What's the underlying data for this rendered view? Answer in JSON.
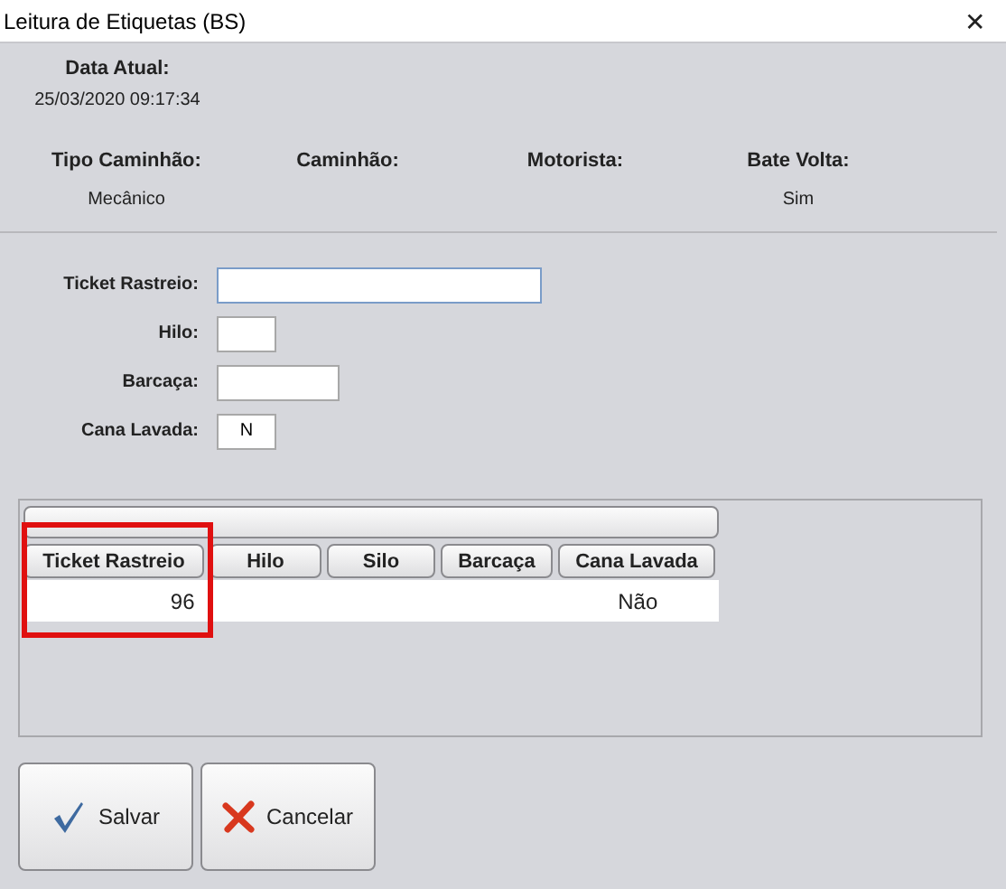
{
  "window": {
    "title": "Leitura de Etiquetas (BS)",
    "close": "✕"
  },
  "date": {
    "label": "Data Atual:",
    "value": "25/03/2020 09:17:34"
  },
  "info": [
    {
      "label": "Tipo Caminhão:",
      "value": "Mecânico"
    },
    {
      "label": "Caminhão:"
    },
    {
      "label": "Motorista:"
    },
    {
      "label": "Bate Volta:",
      "value": "Sim"
    }
  ],
  "form": [
    {
      "label": "Ticket Rastreio:",
      "focused": true
    },
    {
      "label": "Hilo:",
      "focused": false
    },
    {
      "label": "Barcaça:",
      "focused": false
    },
    {
      "label": "Cana Lavada:",
      "focused": false,
      "value": "N"
    }
  ],
  "table": {
    "columns": [
      "Ticket Rastreio",
      "Hilo",
      "Silo",
      "Barcaça",
      "Cana Lavada"
    ],
    "rows": [
      {
        "cells": [
          "96",
          "",
          "",
          "",
          "Não"
        ]
      }
    ],
    "highlight_first_column": true
  },
  "buttons": [
    {
      "label": "Salvar",
      "kind": "save"
    },
    {
      "label": "Cancelar",
      "kind": "cancel"
    }
  ]
}
